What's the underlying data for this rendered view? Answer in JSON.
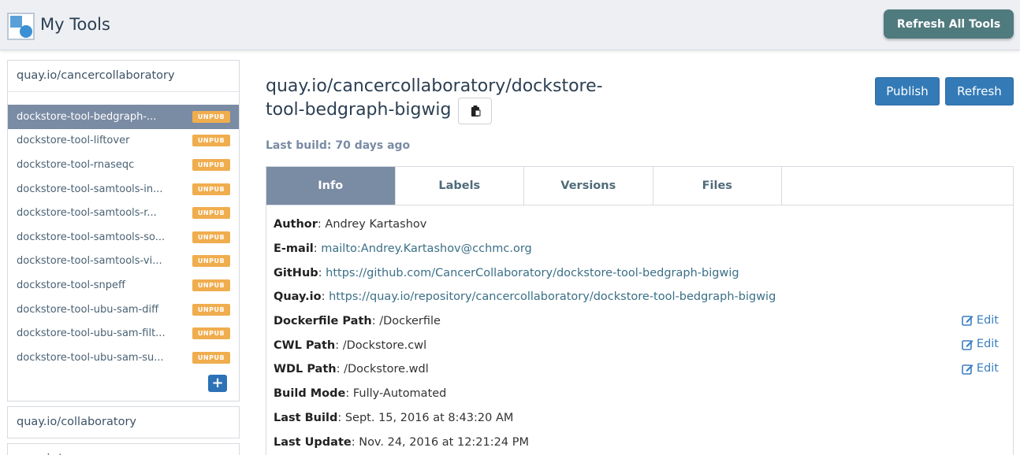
{
  "header": {
    "title": "My Tools",
    "refresh_all_label": "Refresh All Tools"
  },
  "sidebar": {
    "groups": [
      {
        "label": "quay.io/cancercollaboratory"
      },
      {
        "label": "quay.io/collaboratory"
      },
      {
        "label": "quay.io/..."
      }
    ],
    "tools": [
      {
        "name": "dockstore-tool-bedgraph-...",
        "badge": "UNPUB",
        "active": true
      },
      {
        "name": "dockstore-tool-liftover",
        "badge": "UNPUB"
      },
      {
        "name": "dockstore-tool-rnaseqc",
        "badge": "UNPUB"
      },
      {
        "name": "dockstore-tool-samtools-in...",
        "badge": "UNPUB"
      },
      {
        "name": "dockstore-tool-samtools-r...",
        "badge": "UNPUB"
      },
      {
        "name": "dockstore-tool-samtools-so...",
        "badge": "UNPUB"
      },
      {
        "name": "dockstore-tool-samtools-vi...",
        "badge": "UNPUB"
      },
      {
        "name": "dockstore-tool-snpeff",
        "badge": "UNPUB"
      },
      {
        "name": "dockstore-tool-ubu-sam-diff",
        "badge": "UNPUB"
      },
      {
        "name": "dockstore-tool-ubu-sam-filt...",
        "badge": "UNPUB"
      },
      {
        "name": "dockstore-tool-ubu-sam-su...",
        "badge": "UNPUB"
      }
    ],
    "add_icon": "plus-icon",
    "add_glyph": "+"
  },
  "main": {
    "title_line1": "quay.io/cancercollaboratory/dockstore-",
    "title_line2": "tool-bedgraph-bigwig",
    "publish_label": "Publish",
    "refresh_label": "Refresh",
    "last_build": "Last build: 70 days ago",
    "tabs": [
      {
        "label": "Info",
        "active": true
      },
      {
        "label": "Labels"
      },
      {
        "label": "Versions"
      },
      {
        "label": "Files"
      }
    ],
    "info": {
      "author_label": "Author",
      "author": "Andrey Kartashov",
      "email_label": "E-mail",
      "email": "mailto:Andrey.Kartashov@cchmc.org",
      "github_label": "GitHub",
      "github": "https://github.com/CancerCollaboratory/dockstore-tool-bedgraph-bigwig",
      "quay_label": "Quay.io",
      "quay": "https://quay.io/repository/cancercollaboratory/dockstore-tool-bedgraph-bigwig",
      "dockerfile_label": "Dockerfile Path",
      "dockerfile": "/Dockerfile",
      "cwl_label": "CWL Path",
      "cwl": "/Dockstore.cwl",
      "wdl_label": "WDL Path",
      "wdl": "/Dockstore.wdl",
      "build_mode_label": "Build Mode",
      "build_mode": "Fully-Automated",
      "last_build_label": "Last Build",
      "last_build": "Sept. 15, 2016 at 8:43:20 AM",
      "last_update_label": "Last Update",
      "last_update": "Nov. 24, 2016 at 12:21:24 PM",
      "edit_label": "Edit"
    }
  },
  "colors": {
    "accent": "#7a8ba4",
    "primary": "#337ab7",
    "badge": "#f0ad4e",
    "header_button": "#4f7a7e"
  }
}
